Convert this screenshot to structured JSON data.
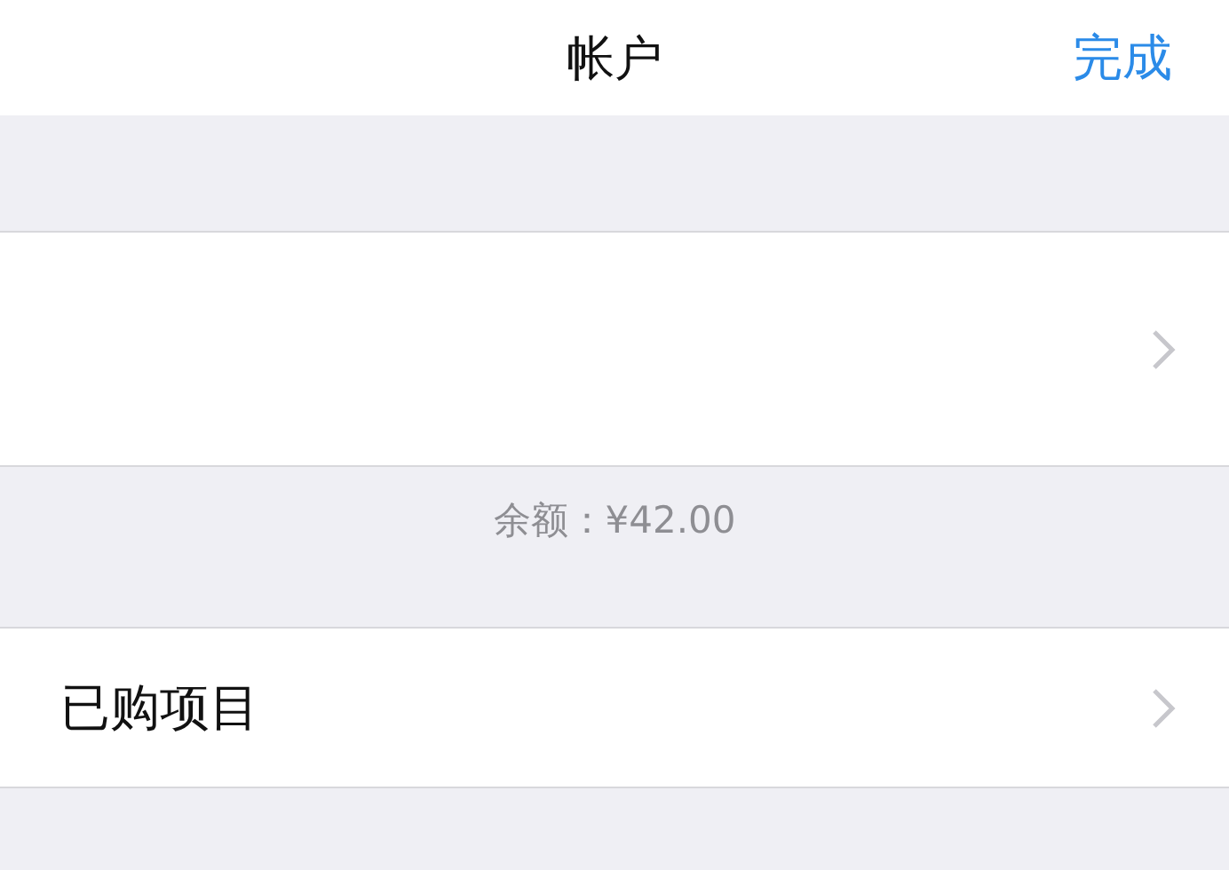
{
  "nav_bar": {
    "title": "帐户",
    "done_button": "完成"
  },
  "balance": "余额：¥42.00",
  "purchased_row": {
    "label": "已购项目"
  }
}
